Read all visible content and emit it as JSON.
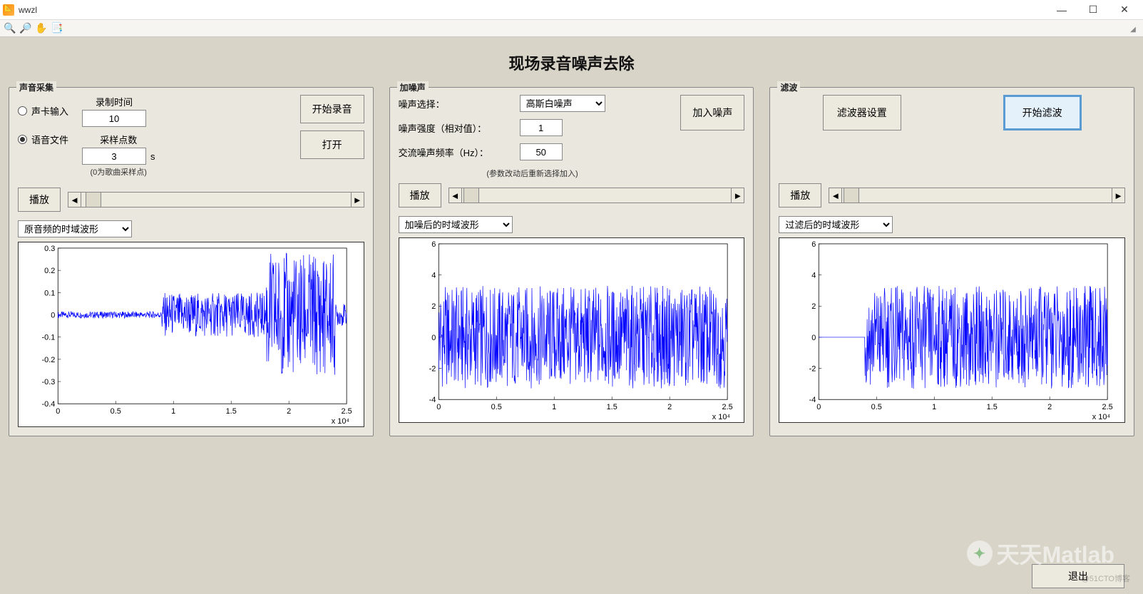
{
  "window": {
    "title": "wwzl"
  },
  "win_controls": {
    "min": "—",
    "max": "☐",
    "close": "✕"
  },
  "toolbar": {
    "zoom_in": "🔍+",
    "zoom_out": "🔍-",
    "pan": "✋",
    "data_cursor": "📄"
  },
  "main_title": "现场录音噪声去除",
  "panel1": {
    "legend": "声音采集",
    "radio_soundcard": "声卡输入",
    "radio_file": "语音文件",
    "rec_time_label": "录制时间",
    "rec_time_value": "10",
    "sample_label": "采样点数",
    "sample_value": "3",
    "sample_unit": "s",
    "sample_note": "(0为歌曲采样点)",
    "btn_start_rec": "开始录音",
    "btn_open": "打开",
    "btn_play": "播放",
    "combo_wave": "原音频的时域波形"
  },
  "panel2": {
    "legend": "加噪声",
    "noise_select_label": "噪声选择：",
    "noise_select_value": "高斯白噪声",
    "noise_strength_label": "噪声强度（相对值）：",
    "noise_strength_value": "1",
    "ac_freq_label": "交流噪声频率（Hz）：",
    "ac_freq_value": "50",
    "param_note": "(参数改动后重新选择加入)",
    "btn_add_noise": "加入噪声",
    "btn_play": "播放",
    "combo_wave": "加噪后的时域波形"
  },
  "panel3": {
    "legend": "滤波",
    "btn_filter_setting": "滤波器设置",
    "btn_start_filter": "开始滤波",
    "btn_play": "播放",
    "combo_wave": "过滤后的时域波形"
  },
  "btn_exit": "退出",
  "watermark": "天天Matlab",
  "small_watermark": "@51CTO博客",
  "chart_data": [
    {
      "type": "line",
      "title": "",
      "xlim": [
        0,
        2.5
      ],
      "ylim": [
        -0.4,
        0.3
      ],
      "yticks": [
        -0.4,
        -0.3,
        -0.2,
        -0.1,
        0,
        0.1,
        0.2,
        0.3
      ],
      "xticks": [
        0,
        0.5,
        1,
        1.5,
        2,
        2.5
      ],
      "x_exponent": "x 10^4",
      "description": "clean speech time-domain waveform, low amplitude near 0 until ~0.9, moderate burst 0.9-1.8 peaking ±0.12, large burst 1.9-2.4 peaking ±0.3"
    },
    {
      "type": "line",
      "title": "",
      "xlim": [
        0,
        2.5
      ],
      "ylim": [
        -4,
        6
      ],
      "yticks": [
        -4,
        -2,
        0,
        2,
        4,
        6
      ],
      "xticks": [
        0,
        0.5,
        1,
        1.5,
        2,
        2.5
      ],
      "x_exponent": "x 10^4",
      "description": "noisy signal dense Gaussian noise roughly uniform amplitude ±3.5 across full range"
    },
    {
      "type": "line",
      "title": "",
      "xlim": [
        0,
        2.5
      ],
      "ylim": [
        -4,
        6
      ],
      "yticks": [
        -4,
        -2,
        0,
        2,
        4,
        6
      ],
      "xticks": [
        0,
        0.5,
        1,
        1.5,
        2,
        2.5
      ],
      "x_exponent": "x 10^4",
      "description": "filtered signal: flat 0 until ~0.4, then dense noise amplitude ±3.5 from 0.4 to 2.5"
    }
  ]
}
